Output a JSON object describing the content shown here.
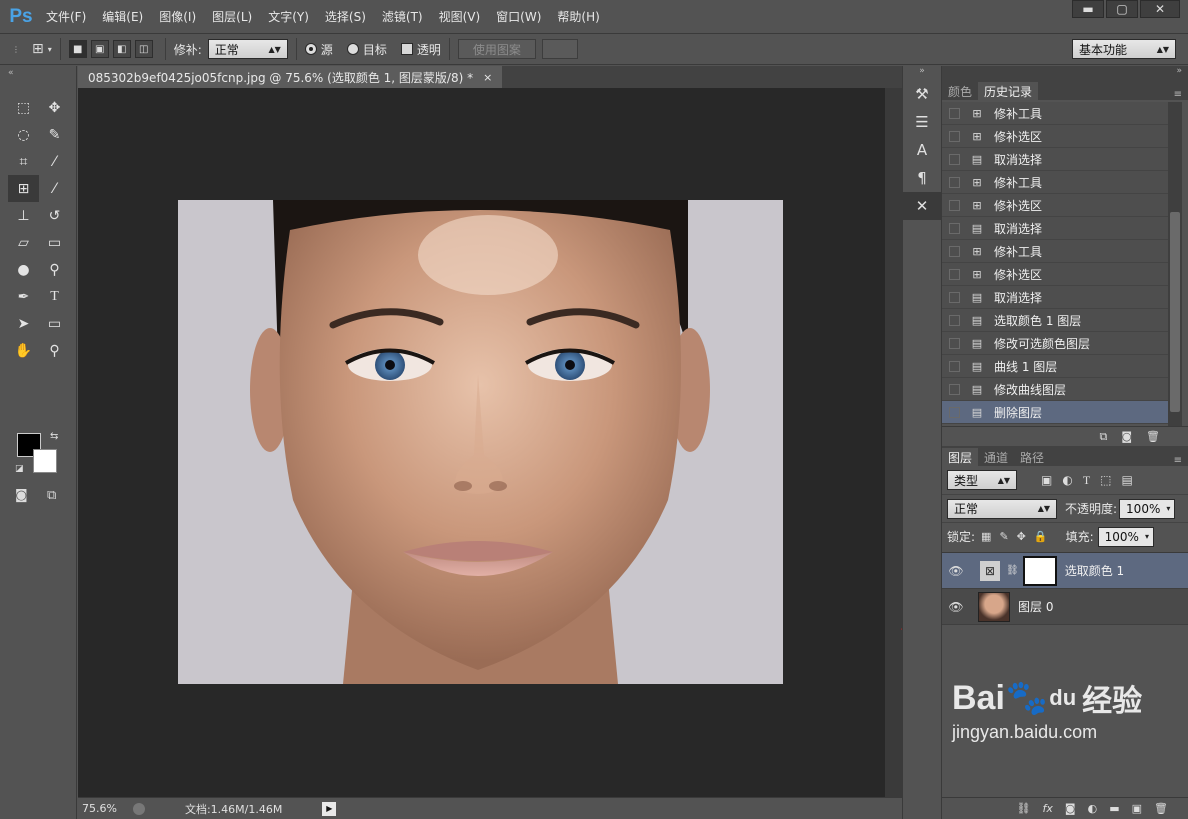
{
  "app": {
    "logo": "Ps"
  },
  "menu": [
    "文件(F)",
    "编辑(E)",
    "图像(I)",
    "图层(L)",
    "文字(Y)",
    "选择(S)",
    "滤镜(T)",
    "视图(V)",
    "窗口(W)",
    "帮助(H)"
  ],
  "window_controls": {
    "minimize": "▬",
    "maximize": "▢",
    "close": "✕"
  },
  "options": {
    "patch_label": "修补:",
    "patch_mode": "正常",
    "source_label": "源",
    "target_label": "目标",
    "transparent_label": "透明",
    "use_pattern_label": "使用图案",
    "workspace": "基本功能"
  },
  "document": {
    "tab_title": "085302b9ef0425jo05fcnp.jpg @ 75.6% (选取颜色 1, 图层蒙版/8) *",
    "close_glyph": "×"
  },
  "status": {
    "zoom": "75.6%",
    "doc_info": "文档:1.46M/1.46M"
  },
  "history_panel": {
    "tabs": [
      "颜色",
      "历史记录"
    ],
    "active_tab": "历史记录",
    "items": [
      {
        "icon": "patch-icon",
        "label": "修补工具"
      },
      {
        "icon": "patch-icon",
        "label": "修补选区"
      },
      {
        "icon": "document-icon",
        "label": "取消选择"
      },
      {
        "icon": "patch-icon",
        "label": "修补工具"
      },
      {
        "icon": "patch-icon",
        "label": "修补选区"
      },
      {
        "icon": "document-icon",
        "label": "取消选择"
      },
      {
        "icon": "patch-icon",
        "label": "修补工具"
      },
      {
        "icon": "patch-icon",
        "label": "修补选区"
      },
      {
        "icon": "document-icon",
        "label": "取消选择"
      },
      {
        "icon": "document-icon",
        "label": "选取颜色 1 图层"
      },
      {
        "icon": "document-icon",
        "label": "修改可选颜色图层"
      },
      {
        "icon": "document-icon",
        "label": "曲线 1 图层"
      },
      {
        "icon": "document-icon",
        "label": "修改曲线图层"
      },
      {
        "icon": "document-icon",
        "label": "删除图层",
        "selected": true
      }
    ]
  },
  "layers_panel": {
    "tabs": [
      "图层",
      "通道",
      "路径"
    ],
    "active_tab": "图层",
    "filter_label": "类型",
    "blend_mode": "正常",
    "opacity_label": "不透明度:",
    "opacity_value": "100%",
    "lock_label": "锁定:",
    "fill_label": "填充:",
    "fill_value": "100%",
    "layers": [
      {
        "name": "选取颜色 1",
        "selected": true
      },
      {
        "name": "图层 0",
        "selected": false
      }
    ]
  },
  "watermark": {
    "brand": "Bai",
    "brand_du": "du",
    "cn": "经验",
    "url": "jingyan.baidu.com"
  },
  "colors": {
    "accent_selected": "#5d6980",
    "background": "#535353",
    "canvas": "#282828",
    "arrow": "#e01b1b"
  }
}
